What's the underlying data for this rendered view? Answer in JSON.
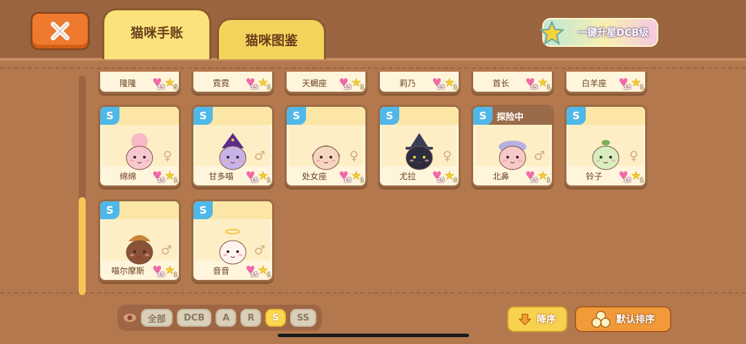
{
  "header": {
    "tabs": [
      {
        "label": "猫咪手账",
        "active": true
      },
      {
        "label": "猫咪图鉴",
        "active": false
      }
    ],
    "upgrade_button": "一键升星DCB级",
    "close_icon": "close-x-icon"
  },
  "top_row_cards": [
    {
      "name": "隆隆",
      "hearts": "15",
      "stars": "5"
    },
    {
      "name": "霓霓",
      "hearts": "15",
      "stars": "1"
    },
    {
      "name": "天蝎座",
      "hearts": "15",
      "stars": "1"
    },
    {
      "name": "莉乃",
      "hearts": "15",
      "stars": "1"
    },
    {
      "name": "首长",
      "hearts": "15",
      "stars": "1"
    },
    {
      "name": "白羊座",
      "hearts": "15",
      "stars": "1"
    }
  ],
  "cards": [
    {
      "name": "绵绵",
      "grade": "S",
      "gender": "♀",
      "hearts": "15",
      "stars": "1",
      "status": ""
    },
    {
      "name": "甘多喵",
      "grade": "S",
      "gender": "♂",
      "hearts": "15",
      "stars": "1",
      "status": ""
    },
    {
      "name": "处女座",
      "grade": "S",
      "gender": "♀",
      "hearts": "15",
      "stars": "1",
      "status": ""
    },
    {
      "name": "尤拉",
      "grade": "S",
      "gender": "♀",
      "hearts": "15",
      "stars": "4",
      "status": ""
    },
    {
      "name": "北鼻",
      "grade": "S",
      "gender": "♂",
      "hearts": "15",
      "stars": "1",
      "status": "探险中"
    },
    {
      "name": "铃子",
      "grade": "S",
      "gender": "♀",
      "hearts": "15",
      "stars": "1",
      "status": ""
    },
    {
      "name": "喵尔摩斯",
      "grade": "S",
      "gender": "♂",
      "hearts": "15",
      "stars": "1",
      "status": ""
    },
    {
      "name": "音音",
      "grade": "S",
      "gender": "♂",
      "hearts": "15",
      "stars": "1",
      "status": ""
    }
  ],
  "filters": {
    "items": [
      "全部",
      "DCB",
      "A",
      "R",
      "S",
      "SS"
    ],
    "active": "S"
  },
  "sort": {
    "desc_label": "降序",
    "default_label": "默认排序"
  },
  "colors": {
    "accent_yellow": "#f6d964",
    "grade_blue": "#4fb8e8",
    "close_orange": "#ef7a2e",
    "background_brown": "#b4784e"
  }
}
